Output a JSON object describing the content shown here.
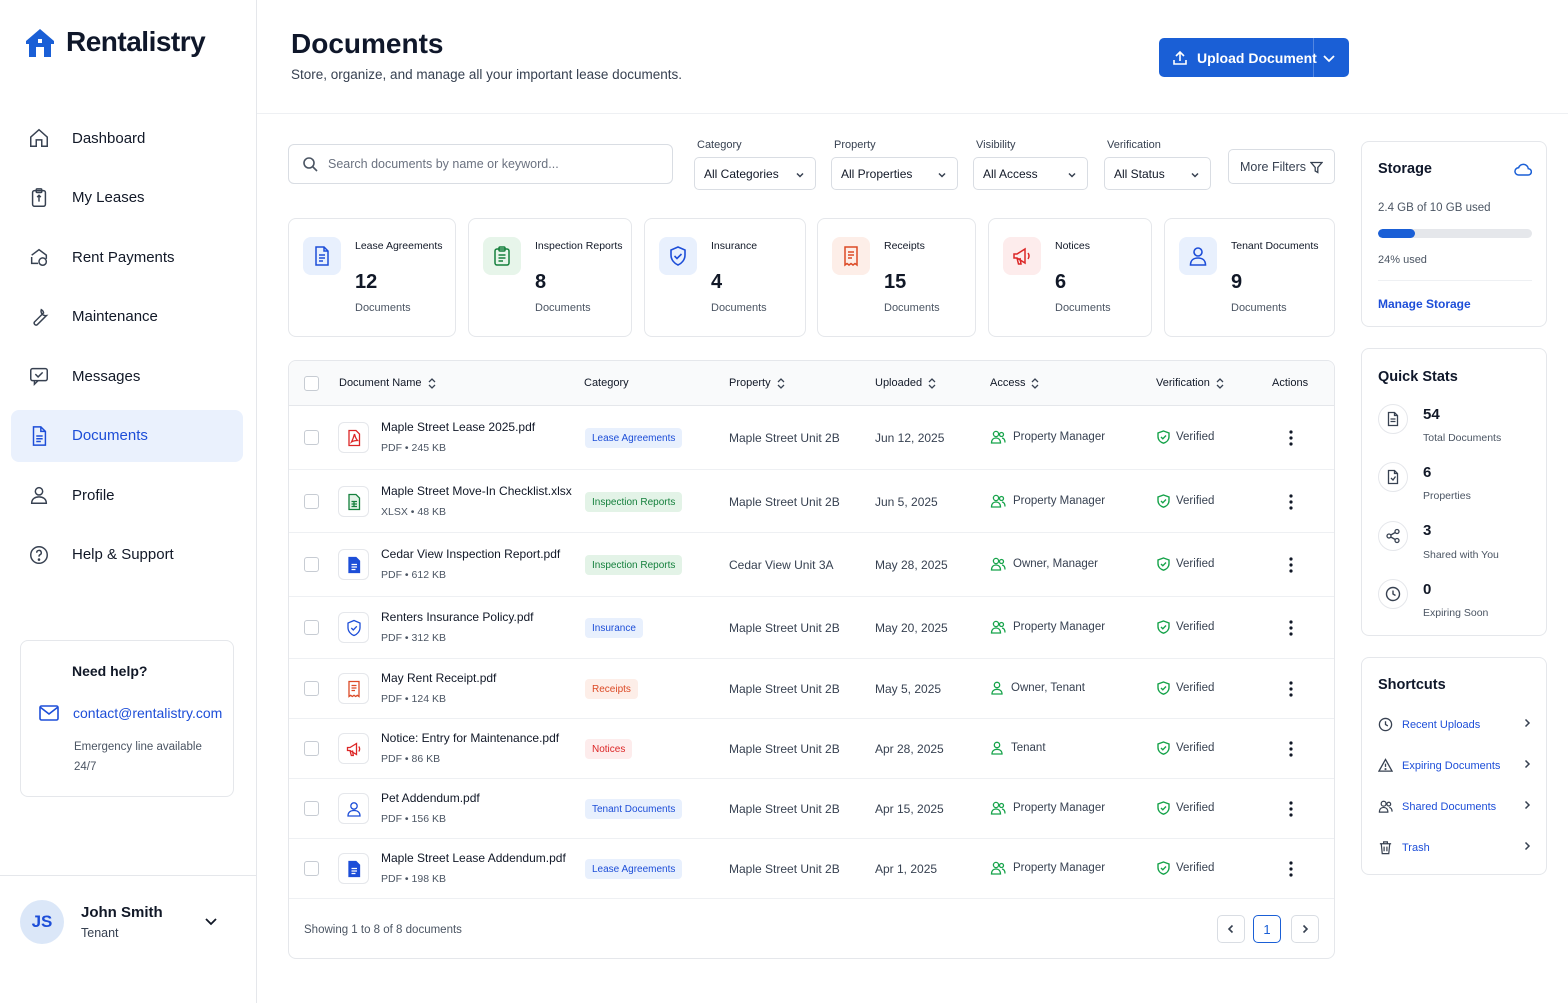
{
  "brand": {
    "name": "Rentalistry",
    "accent": "#1a5fd6"
  },
  "nav": [
    {
      "label": "Dashboard",
      "icon": "home-icon"
    },
    {
      "label": "My Leases",
      "icon": "lease-icon"
    },
    {
      "label": "Rent Payments",
      "icon": "payments-icon"
    },
    {
      "label": "Maintenance",
      "icon": "wrench-icon"
    },
    {
      "label": "Messages",
      "icon": "message-icon"
    },
    {
      "label": "Documents",
      "icon": "document-icon",
      "active": true
    },
    {
      "label": "Profile",
      "icon": "user-icon"
    },
    {
      "label": "Help & Support",
      "icon": "help-icon"
    }
  ],
  "help": {
    "title": "Need help?",
    "email": "contact@rentalistry.com",
    "note": "Emergency line available 24/7"
  },
  "user": {
    "initials": "JS",
    "name": "John Smith",
    "role": "Tenant"
  },
  "header": {
    "title": "Documents",
    "subtitle": "Store, organize, and manage all your important lease documents.",
    "upload_label": "Upload Document"
  },
  "filters": {
    "search_placeholder": "Search documents by name or keyword...",
    "category": {
      "label": "Category",
      "value": "All Categories"
    },
    "property": {
      "label": "Property",
      "value": "All Properties"
    },
    "visibility": {
      "label": "Visibility",
      "value": "All Access"
    },
    "verification": {
      "label": "Verification",
      "value": "All Status"
    },
    "more_label": "More Filters"
  },
  "categories": [
    {
      "title": "Lease Agreements",
      "count": "12",
      "unit": "Documents",
      "icon": "lease-doc-icon",
      "color": "#1d4ed8",
      "bg": "#e8f0fd"
    },
    {
      "title": "Inspection Reports",
      "count": "8",
      "unit": "Documents",
      "icon": "clipboard-icon",
      "color": "#15803d",
      "bg": "#e7f5ea"
    },
    {
      "title": "Insurance",
      "count": "4",
      "unit": "Documents",
      "icon": "shield-icon",
      "color": "#1d4ed8",
      "bg": "#e8f0fd"
    },
    {
      "title": "Receipts",
      "count": "15",
      "unit": "Documents",
      "icon": "receipt-icon",
      "color": "#dc4a26",
      "bg": "#fdeee8"
    },
    {
      "title": "Notices",
      "count": "6",
      "unit": "Documents",
      "icon": "megaphone-icon",
      "color": "#dc2626",
      "bg": "#fdecec"
    },
    {
      "title": "Tenant Documents",
      "count": "9",
      "unit": "Documents",
      "icon": "user-icon",
      "color": "#1d4ed8",
      "bg": "#e8f0fd"
    }
  ],
  "table": {
    "columns": [
      "Document Name",
      "Category",
      "Property",
      "Uploaded",
      "Access",
      "Verification",
      "Actions"
    ],
    "rows": [
      {
        "name": "Maple Street Lease 2025.pdf",
        "meta": "PDF • 245 KB",
        "file_icon": "pdf-icon",
        "category": "Lease Agreements",
        "property": "Maple Street Unit 2B",
        "uploaded": "Jun 12, 2025",
        "access": "Property Manager",
        "access_icon": "users-icon",
        "verification": "Verified"
      },
      {
        "name": "Maple Street Move-In Checklist.xlsx",
        "meta": "XLSX • 48 KB",
        "file_icon": "spreadsheet-icon",
        "category": "Inspection Reports",
        "property": "Maple Street Unit 2B",
        "uploaded": "Jun 5, 2025",
        "access": "Property Manager",
        "access_icon": "users-icon",
        "verification": "Verified"
      },
      {
        "name": "Cedar View Inspection Report.pdf",
        "meta": "PDF • 612 KB",
        "file_icon": "doc-icon",
        "category": "Inspection Reports",
        "property": "Cedar View Unit 3A",
        "uploaded": "May 28, 2025",
        "access": "Owner, Manager",
        "access_icon": "users-icon",
        "verification": "Verified"
      },
      {
        "name": "Renters Insurance Policy.pdf",
        "meta": "PDF • 312 KB",
        "file_icon": "shield-icon",
        "category": "Insurance",
        "property": "Maple Street Unit 2B",
        "uploaded": "May 20, 2025",
        "access": "Property Manager",
        "access_icon": "users-icon",
        "verification": "Verified"
      },
      {
        "name": "May Rent Receipt.pdf",
        "meta": "PDF • 124 KB",
        "file_icon": "receipt-icon",
        "category": "Receipts",
        "property": "Maple Street Unit 2B",
        "uploaded": "May 5, 2025",
        "access": "Owner, Tenant",
        "access_icon": "user-icon",
        "verification": "Verified"
      },
      {
        "name": "Notice: Entry for Maintenance.pdf",
        "meta": "PDF • 86 KB",
        "file_icon": "megaphone-icon",
        "category": "Notices",
        "property": "Maple Street Unit 2B",
        "uploaded": "Apr 28, 2025",
        "access": "Tenant",
        "access_icon": "user-icon",
        "verification": "Verified"
      },
      {
        "name": "Pet Addendum.pdf",
        "meta": "PDF • 156 KB",
        "file_icon": "user-icon",
        "category": "Tenant Documents",
        "property": "Maple Street Unit 2B",
        "uploaded": "Apr 15, 2025",
        "access": "Property Manager",
        "access_icon": "users-icon",
        "verification": "Verified"
      },
      {
        "name": "Maple Street Lease Addendum.pdf",
        "meta": "PDF • 198 KB",
        "file_icon": "doc-icon",
        "category": "Lease Agreements",
        "property": "Maple Street Unit 2B",
        "uploaded": "Apr 1, 2025",
        "access": "Property Manager",
        "access_icon": "users-icon",
        "verification": "Verified"
      }
    ],
    "footer": "Showing 1 to 8 of 8 documents",
    "current_page": "1"
  },
  "storage": {
    "title": "Storage",
    "used_text": "2.4 GB of 10 GB used",
    "percent": 24,
    "percent_text": "24% used",
    "manage_label": "Manage Storage"
  },
  "quick_stats": {
    "title": "Quick Stats",
    "items": [
      {
        "value": "54",
        "label": "Total Documents",
        "icon": "document-icon"
      },
      {
        "value": "6",
        "label": "Properties",
        "icon": "document-icon"
      },
      {
        "value": "3",
        "label": "Shared with You",
        "icon": "share-icon"
      },
      {
        "value": "0",
        "label": "Expiring Soon",
        "icon": "clock-icon"
      }
    ]
  },
  "shortcuts": {
    "title": "Shortcuts",
    "items": [
      {
        "label": "Recent Uploads",
        "icon": "clock-icon"
      },
      {
        "label": "Expiring Documents",
        "icon": "warning-icon"
      },
      {
        "label": "Shared Documents",
        "icon": "users-icon"
      },
      {
        "label": "Trash",
        "icon": "trash-icon"
      }
    ]
  },
  "pill_colors": {
    "Lease Agreements": {
      "fg": "#1d4ed8",
      "bg": "#e8f0fd"
    },
    "Inspection Reports": {
      "fg": "#15803d",
      "bg": "#e3f3e7"
    },
    "Insurance": {
      "fg": "#1d4ed8",
      "bg": "#e8f0fd"
    },
    "Receipts": {
      "fg": "#dc4a26",
      "bg": "#fdeee8"
    },
    "Notices": {
      "fg": "#dc2626",
      "bg": "#fdecec"
    },
    "Tenant Documents": {
      "fg": "#1d4ed8",
      "bg": "#e8f0fd"
    }
  }
}
